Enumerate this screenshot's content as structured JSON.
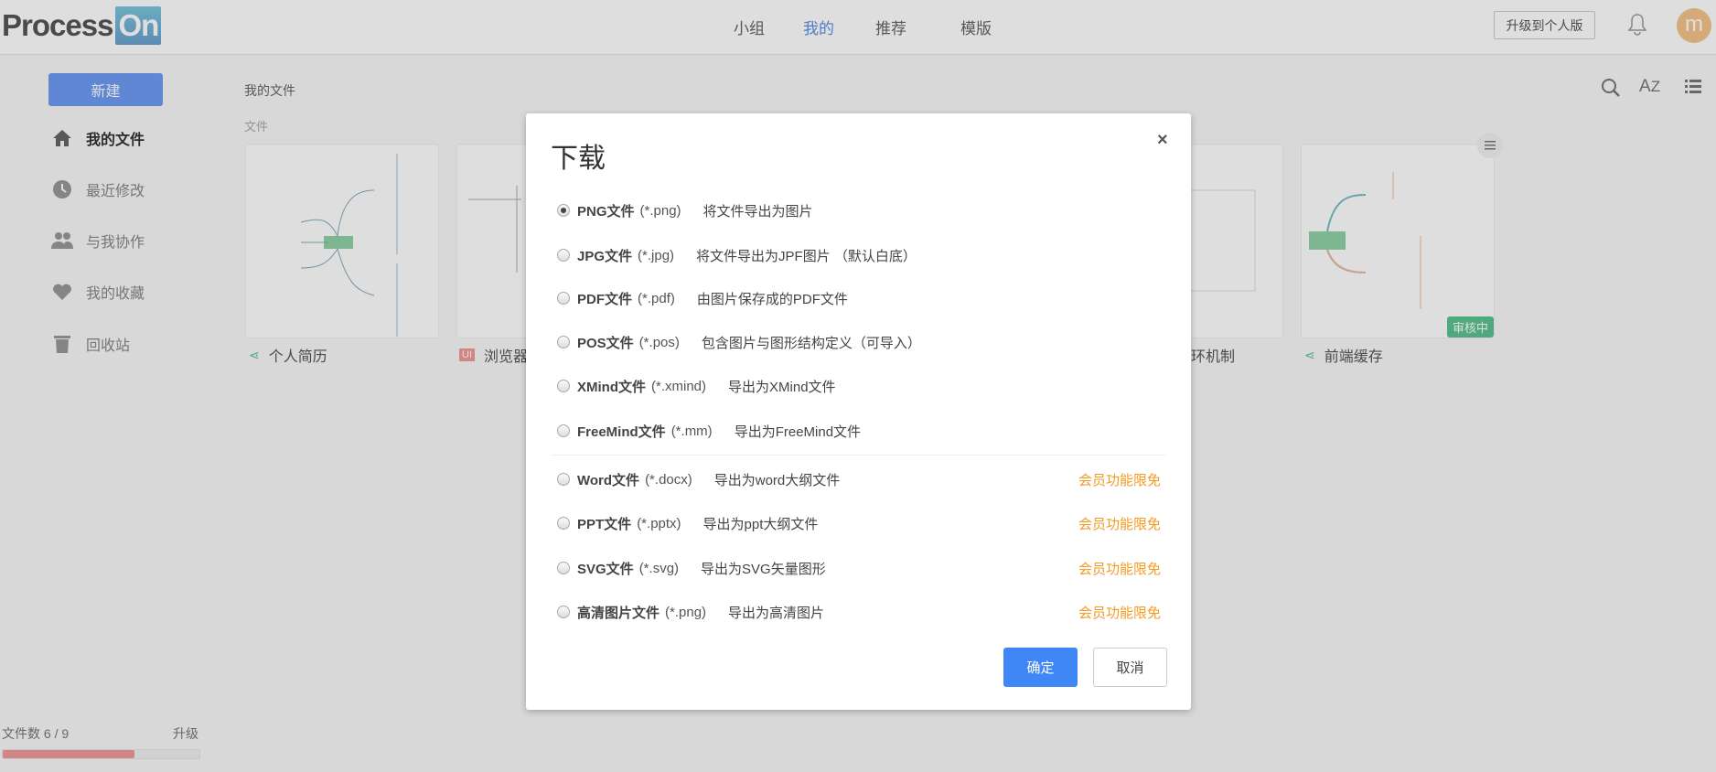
{
  "header": {
    "logo": "ProcessOn",
    "logo_a": "Process",
    "logo_b": "On",
    "nav": [
      "小组",
      "我的",
      "推荐",
      "模版"
    ],
    "active_nav": "我的",
    "upgrade": "升级到个人版",
    "avatar_letter": "m"
  },
  "sidebar": {
    "new_button": "新建",
    "items": [
      {
        "label": "我的文件",
        "icon": "home-icon"
      },
      {
        "label": "最近修改",
        "icon": "clock-icon"
      },
      {
        "label": "与我协作",
        "icon": "users-icon"
      },
      {
        "label": "我的收藏",
        "icon": "heart-icon"
      },
      {
        "label": "回收站",
        "icon": "trash-icon"
      }
    ],
    "file_count": "文件数 6 / 9",
    "file_usage_percent": 67,
    "upgrade_link": "升级"
  },
  "main": {
    "breadcrumb": "我的文件",
    "section": "文件",
    "cards": [
      {
        "title": "个人简历",
        "type": "mindmap"
      },
      {
        "title": "浏览器",
        "type": "ui",
        "badge": "UI"
      },
      {
        "title": "环机制",
        "type": "flowchart"
      },
      {
        "title": "前端缓存",
        "type": "mindmap",
        "status": "审核中"
      }
    ]
  },
  "dialog": {
    "title": "下载",
    "close": "×",
    "options": [
      {
        "name": "PNG文件",
        "ext": "(*.png)",
        "desc": "将文件导出为图片",
        "selected": true
      },
      {
        "name": "JPG文件",
        "ext": "(*.jpg)",
        "desc": "将文件导出为JPF图片 （默认白底）"
      },
      {
        "name": "PDF文件",
        "ext": "(*.pdf)",
        "desc": "由图片保存成的PDF文件"
      },
      {
        "name": "POS文件",
        "ext": "(*.pos)",
        "desc": "包含图片与图形结构定义（可导入）"
      },
      {
        "name": "XMind文件",
        "ext": " (*.xmind)",
        "desc": "导出为XMind文件"
      },
      {
        "name": "FreeMind文件",
        "ext": " (*.mm)",
        "desc": "导出为FreeMind文件"
      },
      {
        "name": "Word文件",
        "ext": "  (*.docx)",
        "desc": "导出为word大纲文件",
        "vip": "会员功能限免"
      },
      {
        "name": "PPT文件",
        "ext": " (*.pptx)",
        "desc": "导出为ppt大纲文件",
        "vip": "会员功能限免"
      },
      {
        "name": "SVG文件",
        "ext": " (*.svg)",
        "desc": "导出为SVG矢量图形",
        "vip": "会员功能限免"
      },
      {
        "name": "高清图片文件",
        "ext": " (*.png)",
        "desc": "导出为高清图片",
        "vip": "会员功能限免"
      }
    ],
    "ok": "确定",
    "cancel": "取消"
  },
  "colors": {
    "primary": "#3f86f7",
    "vip": "#f59a23",
    "usage_bar": "#f19a9a",
    "review_badge": "#5cc38f"
  }
}
